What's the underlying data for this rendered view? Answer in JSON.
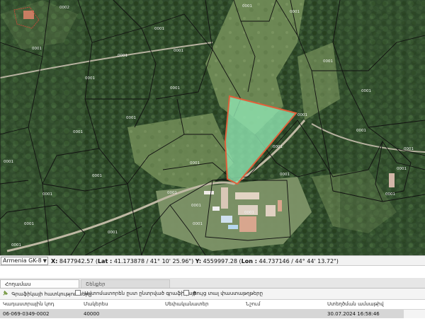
{
  "map": {
    "parcel_labels": [
      "0002",
      "0001",
      "0001",
      "0001",
      "0001",
      "0001",
      "0001",
      "0001",
      "0001",
      "0001",
      "0001",
      "0001",
      "0001",
      "0001",
      "0001",
      "0001",
      "0001",
      "0001",
      "0001",
      "0001",
      "0001",
      "0001",
      "0001",
      "0001",
      "0001",
      "0001",
      "0001",
      "0001",
      "0001",
      "0001",
      "0001"
    ],
    "colors": {
      "selected_fill": "#8fe3b0",
      "selected_outline": "#e0603a",
      "boundary": "#111111",
      "label": "#f0f0f0"
    }
  },
  "coordbar": {
    "crs": "Armenia GK-8",
    "x_label": "X:",
    "x_value": "8477942.57",
    "lat_label": "Lat :",
    "lat_value": "41.173878 / 41° 10' 25.96\"",
    "y_label": "Y:",
    "y_value": "4559997.28",
    "lon_label": "Lon :",
    "lon_value": "44.737146 / 44° 44' 13.72\""
  },
  "panel": {
    "tabs": [
      {
        "label": "Հողամաս",
        "active": true
      },
      {
        "label": "Շենքեր",
        "active": false
      }
    ],
    "toolbar": {
      "attributes_button": "Գրաֆիկայի հատկությունները",
      "checkbox_1": "Ավտոմատորեն ըստ ընտրված գրաֆիկայի",
      "checkbox_2": "Ցույց տալ փաստաթղթերը"
    },
    "columns": [
      "Կադաստրային կոդ",
      "Մակերես",
      "Սեփականատեր",
      "Նշում",
      "Ստեղծման ամսաթիվ"
    ],
    "rows": [
      {
        "code": "06-069-0349-0002",
        "area": "40000",
        "owner": "",
        "note": "",
        "created": "30.07.2024 16:58:46"
      }
    ]
  }
}
